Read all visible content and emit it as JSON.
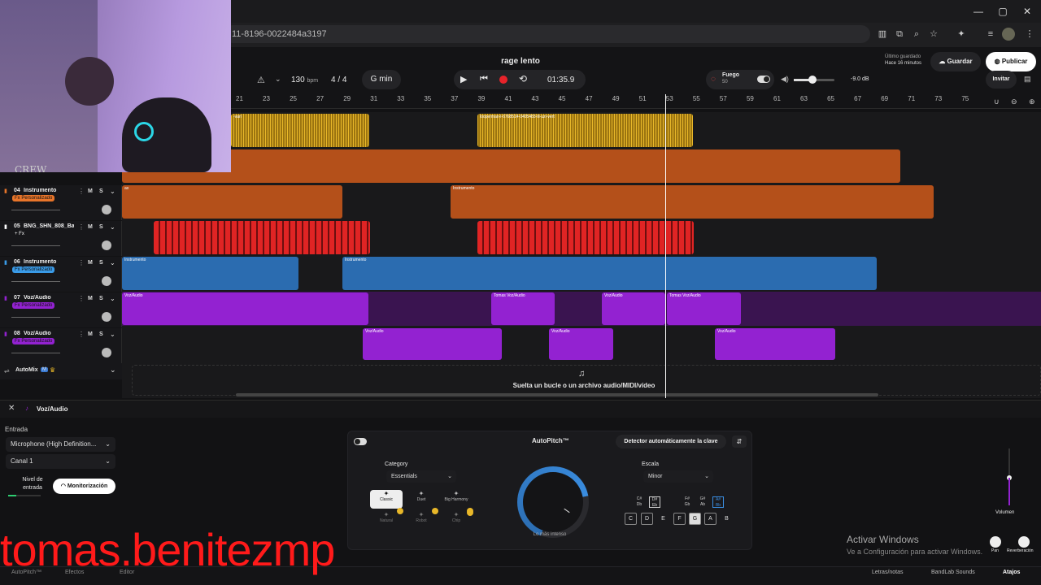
{
  "browser": {
    "url": "11-8196-0022484a3197"
  },
  "project": {
    "title": "rage lento",
    "tempo": "130",
    "tempo_unit": "bpm",
    "meter": "4 / 4",
    "key": "G min",
    "time": "01:35.9"
  },
  "save": {
    "last_saved_label": "Último guardado",
    "last_saved_time": "Hace 16 minutos",
    "save_button": "Guardar",
    "publish_button": "Publicar",
    "invite_button": "Invitar"
  },
  "fx": {
    "name": "Fuego",
    "value": "50",
    "volume": "-9.0 dB"
  },
  "ruler": [
    "21",
    "23",
    "25",
    "27",
    "29",
    "31",
    "33",
    "35",
    "37",
    "39",
    "41",
    "43",
    "45",
    "47",
    "49",
    "51",
    "53",
    "55",
    "57",
    "59",
    "61",
    "63",
    "65",
    "67",
    "69",
    "71",
    "73",
    "75"
  ],
  "tracks": [
    {
      "num": "04",
      "name": "Instrumento",
      "fx": "Fx Personalizado",
      "m": "M",
      "s": "S"
    },
    {
      "num": "05",
      "name": "BNG_SHN_808_Ba...",
      "fx": "+ Fx",
      "m": "M",
      "s": "S"
    },
    {
      "num": "06",
      "name": "Instrumento",
      "fx": "Fx Personalizado",
      "m": "M",
      "s": "S"
    },
    {
      "num": "07",
      "name": "Voz/Audio",
      "fx": "Fx Personalizado",
      "m": "M",
      "s": "S"
    },
    {
      "num": "08",
      "name": "Voz/Audio",
      "fx": "Fx Personalizado",
      "m": "M",
      "s": "S"
    }
  ],
  "clips": {
    "loop1": "-vari",
    "loop2": "looperman-l-6768514-0405483-lil-uzi-vert",
    "instr": "Instrumento",
    "voz": "Voz/Audio",
    "takes": "Tomas",
    "small": "ax"
  },
  "automix": {
    "label": "AutoMix",
    "badge": "M"
  },
  "dropzone": "Suelta un bucle o un archivo audio/MIDI/vídeo",
  "panel": {
    "track_name": "Voz/Audio",
    "input_label": "Entrada",
    "input_device": "Microphone (High Definition...",
    "channel": "Canal 1",
    "level_label": "Nivel de entrada",
    "monitor_button": "Monitorización",
    "autopitch": {
      "title": "AutoPitch™",
      "detect_key": "Detector automáticamente la clave",
      "category_label": "Category",
      "category_value": "Essentials",
      "presets": [
        "Classic",
        "Duet",
        "Big Harmony",
        "Natural",
        "Robot",
        "Chip"
      ],
      "knob_label": "Lo más intenso",
      "scale_label": "Escala",
      "scale_value": "Minor",
      "sharps": [
        "C#\nDb",
        "D#\nEb",
        "F#\nGb",
        "G#\nAb",
        "A#\nBb"
      ],
      "naturals": [
        "C",
        "D",
        "E",
        "F",
        "G",
        "A",
        "B"
      ]
    },
    "volume_label": "Volumen",
    "pan_label": "Pan",
    "reverb_label": "Reverberación"
  },
  "footer": {
    "tabs": [
      "AutoPitch™",
      "Efectos",
      "Editor"
    ],
    "right": [
      "Letras/notas",
      "BandLab Sounds",
      "Atajos"
    ]
  },
  "activate": {
    "title": "Activar Windows",
    "subtitle": "Ve a Configuración para activar Windows."
  },
  "overlay": {
    "watermark": "tomas.benitezmp",
    "webcam_text": "CREW"
  }
}
